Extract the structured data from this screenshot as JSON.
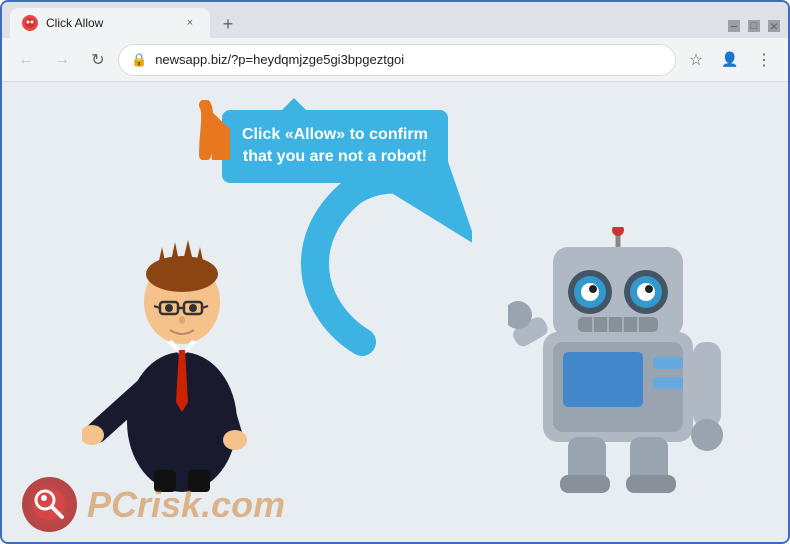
{
  "browser": {
    "tab_title": "Click Allow",
    "tab_favicon": "●",
    "close_btn": "×",
    "new_tab_btn": "+",
    "minimize_label": "−",
    "maximize_label": "□",
    "window_close_label": "×",
    "url": "newsapp.biz/?p=heydqmjzge5gi3bpgeztgoi",
    "nav": {
      "back_icon": "←",
      "forward_icon": "→",
      "refresh_icon": "↻",
      "lock_icon": "🔒",
      "star_icon": "☆",
      "profile_icon": "●",
      "menu_icon": "⋮"
    }
  },
  "content": {
    "callout_line1": "Click «Allow» to confirm",
    "callout_line2": "that you are not a robot!",
    "watermark_text": "risk.com",
    "watermark_prefix": "PC"
  }
}
